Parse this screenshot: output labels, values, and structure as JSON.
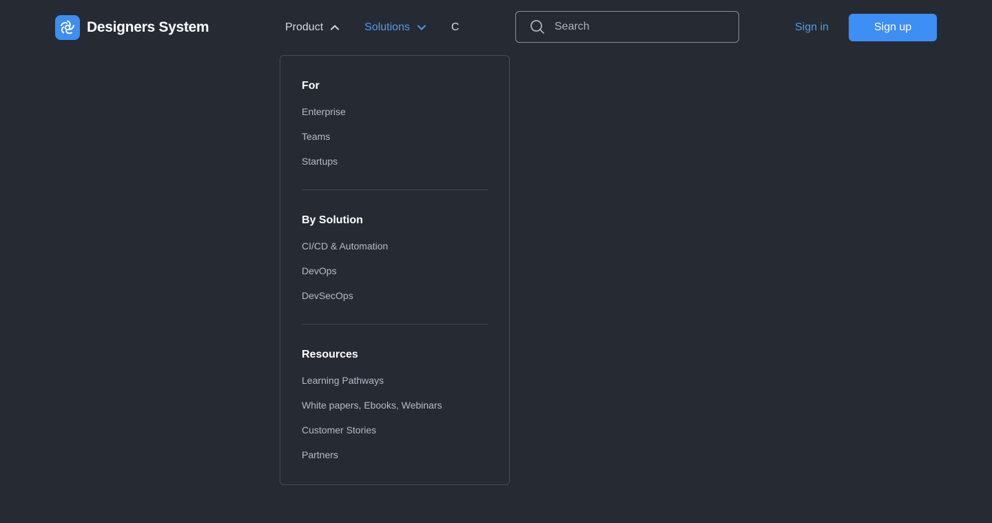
{
  "brand": {
    "name": "Designers System"
  },
  "nav": {
    "items": [
      {
        "label": "Product",
        "state": "expanded"
      },
      {
        "label": "Solutions",
        "state": "active"
      },
      {
        "label": "C"
      }
    ]
  },
  "search": {
    "placeholder": "Search"
  },
  "auth": {
    "sign_in": "Sign in",
    "sign_up": "Sign up"
  },
  "dropdown": {
    "sections": [
      {
        "title": "For",
        "items": [
          "Enterprise",
          "Teams",
          "Startups"
        ]
      },
      {
        "title": "By Solution",
        "items": [
          "CI/CD & Automation",
          "DevOps",
          "DevSecOps"
        ]
      },
      {
        "title": "Resources",
        "items": [
          "Learning Pathways",
          "White papers, Ebooks, Webinars",
          "Customer Stories",
          "Partners"
        ]
      }
    ]
  },
  "colors": {
    "background": "#252a33",
    "accent": "#3d8ef5",
    "link": "#4a9cf7",
    "text_primary": "#ffffff",
    "text_secondary": "#b6bcc5",
    "border": "#474d57"
  },
  "icons": {
    "brand": "aperture-swirl-icon",
    "product_caret": "chevron-up-icon",
    "solutions_caret": "chevron-down-icon",
    "search": "search-icon"
  }
}
